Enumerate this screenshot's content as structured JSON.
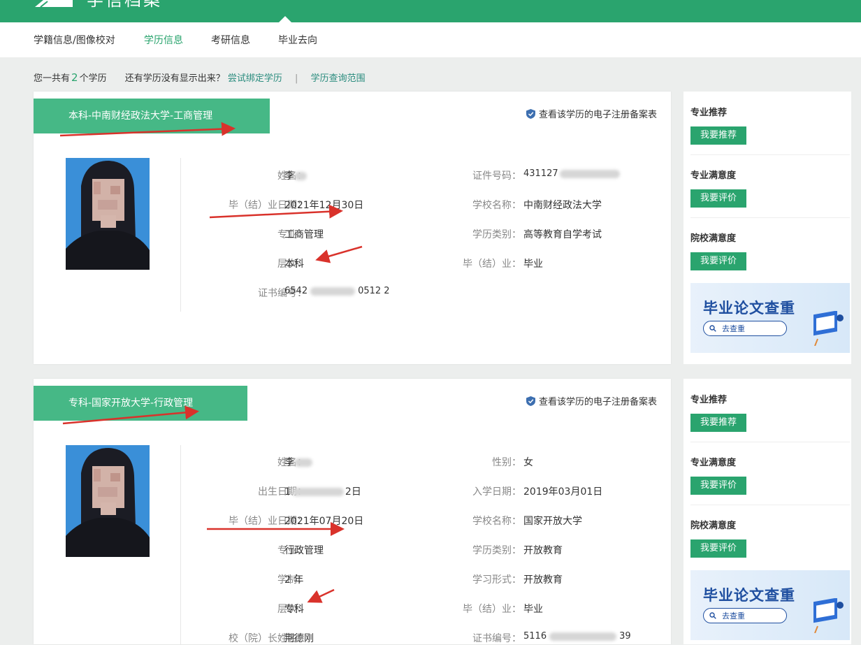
{
  "header": {
    "site_title": "学信档案"
  },
  "nav": {
    "tabs": [
      {
        "label": "学籍信息/图像校对"
      },
      {
        "label": "学历信息"
      },
      {
        "label": "考研信息"
      },
      {
        "label": "毕业去向"
      }
    ],
    "active_tab": "学历信息"
  },
  "summary": {
    "prefix": "您一共有",
    "count": "2",
    "suffix": "个学历",
    "question": "还有学历没有显示出来？",
    "bind_link": "尝试绑定学历",
    "separator": "|",
    "scope_link": "学历查询范围"
  },
  "records": [
    {
      "banner": "本科-中南财经政法大学-工商管理",
      "reg_link": "查看该学历的电子注册备案表",
      "fields_left": [
        {
          "label": "姓名：",
          "value": "李"
        },
        {
          "label": "毕（结）业日期：",
          "value": "2021年12月30日"
        },
        {
          "label": "专业：",
          "value": "工商管理"
        },
        {
          "label": "层次：",
          "value": "本科"
        },
        {
          "label": "证书编号：",
          "value": "6542",
          "value_tail": "0512 2"
        }
      ],
      "fields_right": [
        {
          "label": "证件号码：",
          "value": "431127"
        },
        {
          "label": "学校名称：",
          "value": "中南财经政法大学"
        },
        {
          "label": "学历类别：",
          "value": "高等教育自学考试"
        },
        {
          "label": "毕（结）业：",
          "value": "毕业"
        }
      ]
    },
    {
      "banner": "专科-国家开放大学-行政管理",
      "reg_link": "查看该学历的电子注册备案表",
      "fields_left": [
        {
          "label": "姓名：",
          "value": "李"
        },
        {
          "label": "出生日期：",
          "value": "1",
          "value_tail": "2日"
        },
        {
          "label": "毕（结）业日期：",
          "value": "2021年07月20日"
        },
        {
          "label": "专业：",
          "value": "行政管理"
        },
        {
          "label": "学制：",
          "value": "2 年"
        },
        {
          "label": "层次：",
          "value": "专科"
        },
        {
          "label": "校（院）长姓名：",
          "value": "荆德刚"
        }
      ],
      "fields_right": [
        {
          "label": "性别：",
          "value": "女"
        },
        {
          "label": "入学日期：",
          "value": "2019年03月01日"
        },
        {
          "label": "学校名称：",
          "value": "国家开放大学"
        },
        {
          "label": "学历类别：",
          "value": "开放教育"
        },
        {
          "label": "学习形式：",
          "value": "开放教育"
        },
        {
          "label": "毕（结）业：",
          "value": "毕业"
        },
        {
          "label": "证书编号：",
          "value": "5116",
          "value_tail": "39"
        }
      ]
    }
  ],
  "sidebar": {
    "sections": [
      {
        "heading": "专业推荐",
        "button": "我要推荐"
      },
      {
        "heading": "专业满意度",
        "button": "我要评价"
      },
      {
        "heading": "院校满意度",
        "button": "我要评价"
      }
    ],
    "ad": {
      "title": "毕业论文查重",
      "button": "去查重"
    }
  },
  "colors": {
    "brand_green": "#2aa46e",
    "banner_green": "#46b886",
    "arrow_red": "#d9322b",
    "link_teal": "#2a8c7e"
  }
}
